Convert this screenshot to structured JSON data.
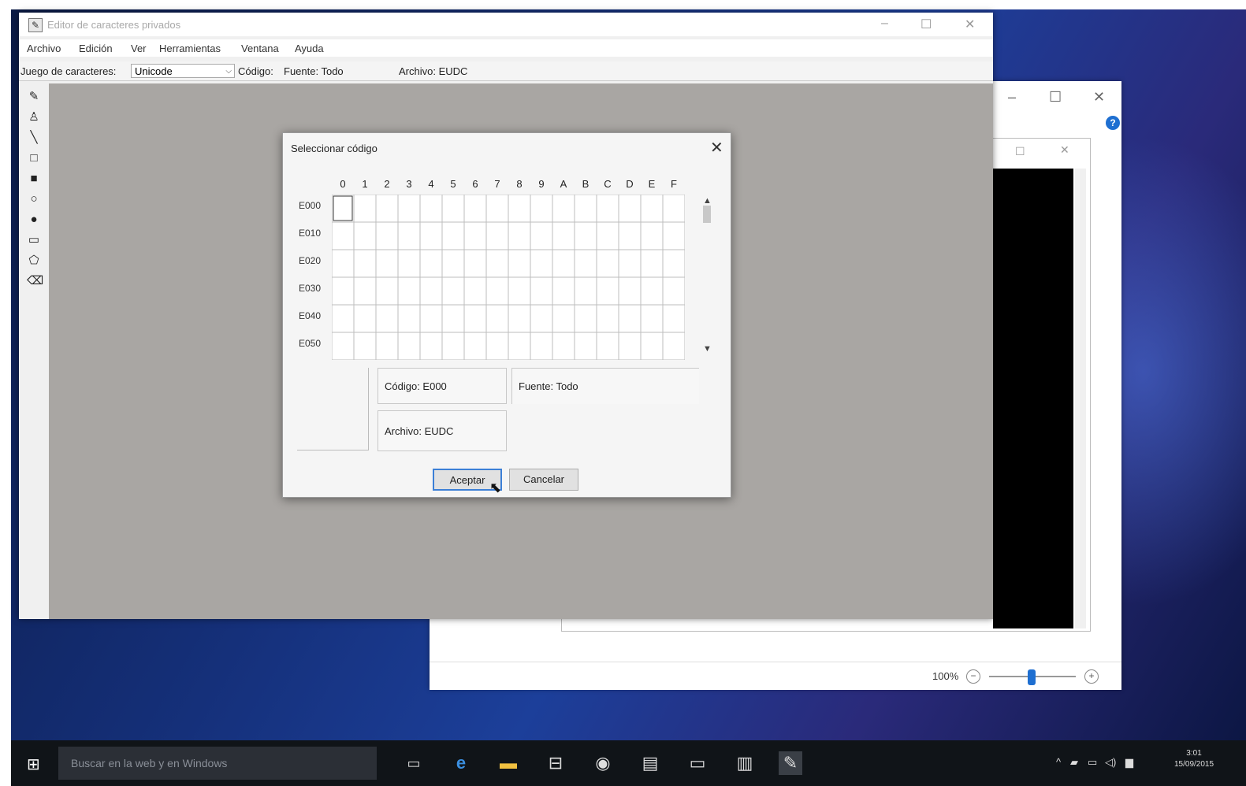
{
  "editor": {
    "title": "Editor de caracteres privados",
    "menu": [
      "Archivo",
      "Edición",
      "Ver",
      "Herramientas",
      "Ventana",
      "Ayuda"
    ],
    "charset_label": "Juego de caracteres:",
    "charset_value": "Unicode",
    "code_label": "Código:",
    "font_label": "Fuente: Todo",
    "file_label": "Archivo: EUDC"
  },
  "dialog": {
    "title": "Seleccionar código",
    "columns": [
      "0",
      "1",
      "2",
      "3",
      "4",
      "5",
      "6",
      "7",
      "8",
      "9",
      "A",
      "B",
      "C",
      "D",
      "E",
      "F"
    ],
    "rows": [
      "E000",
      "E010",
      "E020",
      "E030",
      "E040",
      "E050"
    ],
    "code_info": "Código:  E000",
    "font_info": "Fuente:  Todo",
    "file_info": "Archivo:  EUDC",
    "accept_label": "Aceptar",
    "cancel_label": "Cancelar"
  },
  "viewer": {
    "zoom": "100%",
    "zoom_level": 0.5
  },
  "taskbar": {
    "search_placeholder": "Buscar en la web y en Windows",
    "time": "3:01",
    "date": "15/09/2015"
  }
}
